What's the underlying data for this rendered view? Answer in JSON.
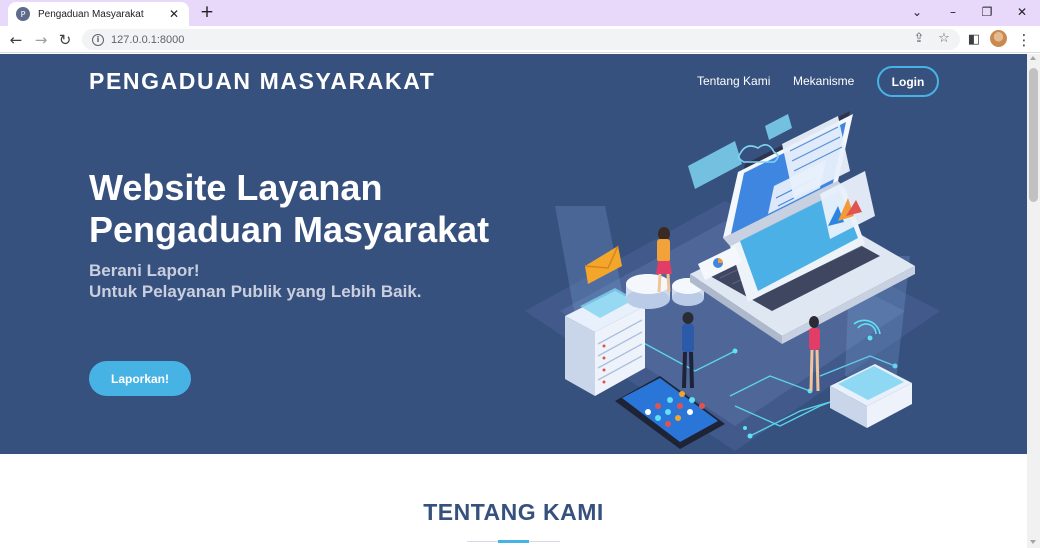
{
  "browser": {
    "tab": {
      "title": "Pengaduan Masyarakat",
      "favicon": "P",
      "close": "✕"
    },
    "new_tab": "+",
    "window_controls": {
      "tab_search": "⌄",
      "minimize": "–",
      "restore": "❐",
      "close": "✕"
    },
    "nav": {
      "back": "←",
      "forward": "→",
      "reload": "↻"
    },
    "url": "127.0.0.1:8000",
    "icons": {
      "share": "⇪",
      "bookmark": "☆",
      "side_panel": "◧",
      "menu": "⋮"
    }
  },
  "page": {
    "brand": "PENGADUAN MASYARAKAT",
    "nav": [
      {
        "label": "Tentang Kami"
      },
      {
        "label": "Mekanisme"
      }
    ],
    "login_label": "Login",
    "hero": {
      "title_line1": "Website Layanan",
      "title_line2": "Pengaduan Masyarakat",
      "subtitle_line1": "Berani Lapor!",
      "subtitle_line2": "Untuk Pelayanan Publik yang Lebih Baik.",
      "cta_label": "Laporkan!"
    },
    "section_title": "TENTANG KAMI"
  },
  "colors": {
    "hero_bg": "#37517e",
    "accent": "#47b2e4",
    "tabbar": "#e8d9fb"
  }
}
